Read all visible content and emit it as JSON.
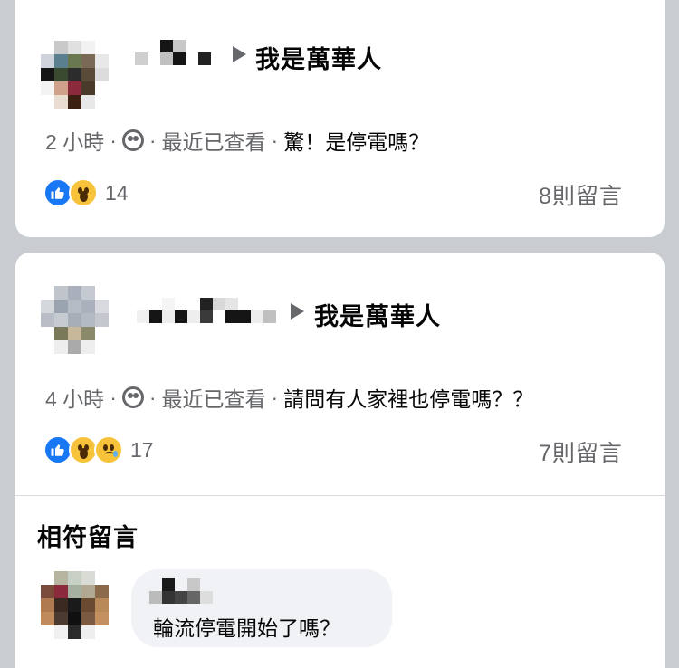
{
  "posts": [
    {
      "group_name": "我是萬華人",
      "time": "2 小時",
      "seen": "最近已查看",
      "text": "驚！是停電嗎？",
      "reactions": [
        "like",
        "wow"
      ],
      "reaction_count": "14",
      "comment_count": "8則留言"
    },
    {
      "group_name": "我是萬華人",
      "time": "4 小時",
      "seen": "最近已查看",
      "text": "請問有人家裡也停電嗎？？",
      "reactions": [
        "like",
        "wow",
        "sad"
      ],
      "reaction_count": "17",
      "comment_count": "7則留言",
      "matching_comments_title": "相符留言",
      "comment": {
        "text": "輪流停電開始了嗎？"
      }
    }
  ],
  "colors": {
    "background": "#c9ccd1",
    "card": "#ffffff",
    "secondary_text": "#65676b",
    "primary_text": "#050505",
    "like_blue": "#1877f2",
    "emoji_yellow": "#f7c33b"
  },
  "icons": {
    "arrow": "right-triangle-icon",
    "audience": "group-audience-icon",
    "like": "like-reaction-icon",
    "wow": "wow-reaction-icon",
    "sad": "sad-reaction-icon"
  }
}
